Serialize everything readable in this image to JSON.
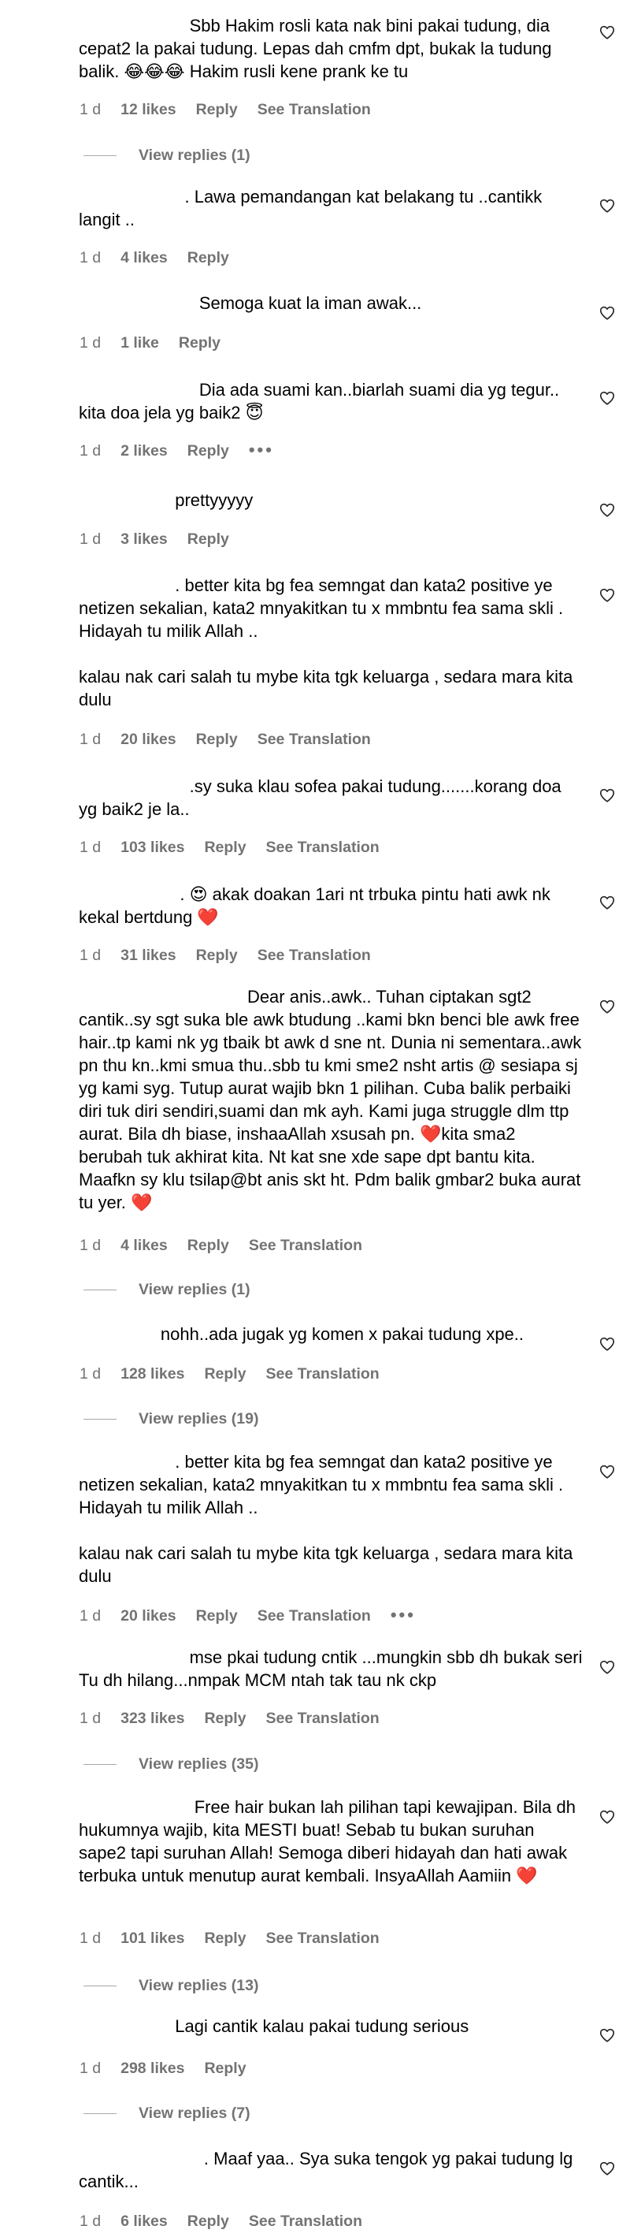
{
  "comments": [
    {
      "text": "                       Sbb Hakim rosli kata nak bini pakai tudung, dia cepat2 la pakai tudung. Lepas dah cmfm dpt, bukak la tudung balik. 😂😂😂 Hakim rusli kene prank ke tu",
      "time": "1 d",
      "likes": "12 likes",
      "reply": "Reply",
      "translation": "See Translation",
      "view_replies": "View replies (1)"
    },
    {
      "text": "                      . Lawa pemandangan kat belakang tu ..cantikk langit ..",
      "time": "1 d",
      "likes": "4 likes",
      "reply": "Reply"
    },
    {
      "text": "                         Semoga kuat la iman awak...",
      "time": "1 d",
      "likes": "1 like",
      "reply": "Reply"
    },
    {
      "text": "                         Dia ada suami kan..biarlah suami dia yg tegur.. kita doa jela yg baik2 😇",
      "time": "1 d",
      "likes": "2 likes",
      "reply": "Reply",
      "more": "•••"
    },
    {
      "text": "                    prettyyyyy",
      "time": "1 d",
      "likes": "3 likes",
      "reply": "Reply"
    },
    {
      "text": "                    . better kita bg fea semngat dan kata2 positive ye netizen sekalian, kata2 mnyakitkan tu x mmbntu fea sama skli . Hidayah tu milik Allah ..\n\nkalau nak cari salah tu mybe kita tgk keluarga , sedara mara kita dulu",
      "time": "1 d",
      "likes": "20 likes",
      "reply": "Reply",
      "translation": "See Translation"
    },
    {
      "text": "                       .sy suka klau sofea pakai tudung.......korang doa yg baik2 je la..",
      "time": "1 d",
      "likes": "103 likes",
      "reply": "Reply",
      "translation": "See Translation"
    },
    {
      "text": "                     . 😍 akak doakan 1ari nt trbuka pintu hati awk nk kekal bertdung ❤️",
      "time": "1 d",
      "likes": "31 likes",
      "reply": "Reply",
      "translation": "See Translation"
    },
    {
      "text": "                                   Dear anis..awk.. Tuhan ciptakan sgt2 cantik..sy sgt suka ble awk btudung ..kami bkn benci ble awk free hair..tp kami nk yg tbaik bt awk d sne nt. Dunia ni sementara..awk pn thu kn..kmi smua thu..sbb tu kmi sme2 nsht artis @ sesiapa sj yg kami syg. Tutup aurat wajib bkn 1 pilihan. Cuba balik perbaiki diri tuk diri sendiri,suami dan mk ayh. Kami juga struggle dlm ttp aurat. Bila dh biase, inshaaAllah xsusah pn. ❤️kita sma2 berubah tuk akhirat kita. Nt kat sne xde sape dpt bantu kita. Maafkn sy klu tsilap@bt anis skt ht. Pdm balik gmbar2 buka aurat tu yer. ❤️",
      "time": "1 d",
      "likes": "4 likes",
      "reply": "Reply",
      "translation": "See Translation",
      "view_replies": "View replies (1)"
    },
    {
      "text": "                 nohh..ada jugak yg komen x pakai tudung xpe..",
      "time": "1 d",
      "likes": "128 likes",
      "reply": "Reply",
      "translation": "See Translation",
      "view_replies": "View replies (19)"
    },
    {
      "text": "                    . better kita bg fea semngat dan kata2 positive ye netizen sekalian, kata2 mnyakitkan tu x mmbntu fea sama skli . Hidayah tu milik Allah ..\n\nkalau nak cari salah tu mybe kita tgk keluarga , sedara mara kita dulu",
      "time": "1 d",
      "likes": "20 likes",
      "reply": "Reply",
      "translation": "See Translation",
      "more": "•••"
    },
    {
      "text": "                       mse pkai tudung cntik ...mungkin sbb dh bukak seri Tu dh hilang...nmpak MCM ntah tak tau nk ckp",
      "time": "1 d",
      "likes": "323 likes",
      "reply": "Reply",
      "translation": "See Translation",
      "view_replies": "View replies (35)"
    },
    {
      "text": "                        Free hair bukan lah pilihan tapi kewajipan. Bila dh hukumnya wajib, kita MESTI buat! Sebab tu bukan suruhan sape2 tapi suruhan Allah! Semoga diberi hidayah dan hati awak terbuka untuk menutup aurat kembali. InsyaAllah Aamiin ❤️",
      "time": "1 d",
      "likes": "101 likes",
      "reply": "Reply",
      "translation": "See Translation",
      "view_replies": "View replies (13)"
    },
    {
      "text": "                    Lagi cantik kalau pakai tudung serious",
      "time": "1 d",
      "likes": "298 likes",
      "reply": "Reply",
      "view_replies": "View replies (7)"
    },
    {
      "text": "                          . Maaf yaa.. Sya suka tengok yg pakai tudung lg cantik...",
      "time": "1 d",
      "likes": "6 likes",
      "reply": "Reply",
      "translation": "See Translation"
    }
  ],
  "icons": {
    "like": "heart-outline-icon",
    "more": "more-dots-icon"
  },
  "colors": {
    "text": "#000000",
    "meta": "#737373",
    "divider": "#a8a8a8"
  }
}
